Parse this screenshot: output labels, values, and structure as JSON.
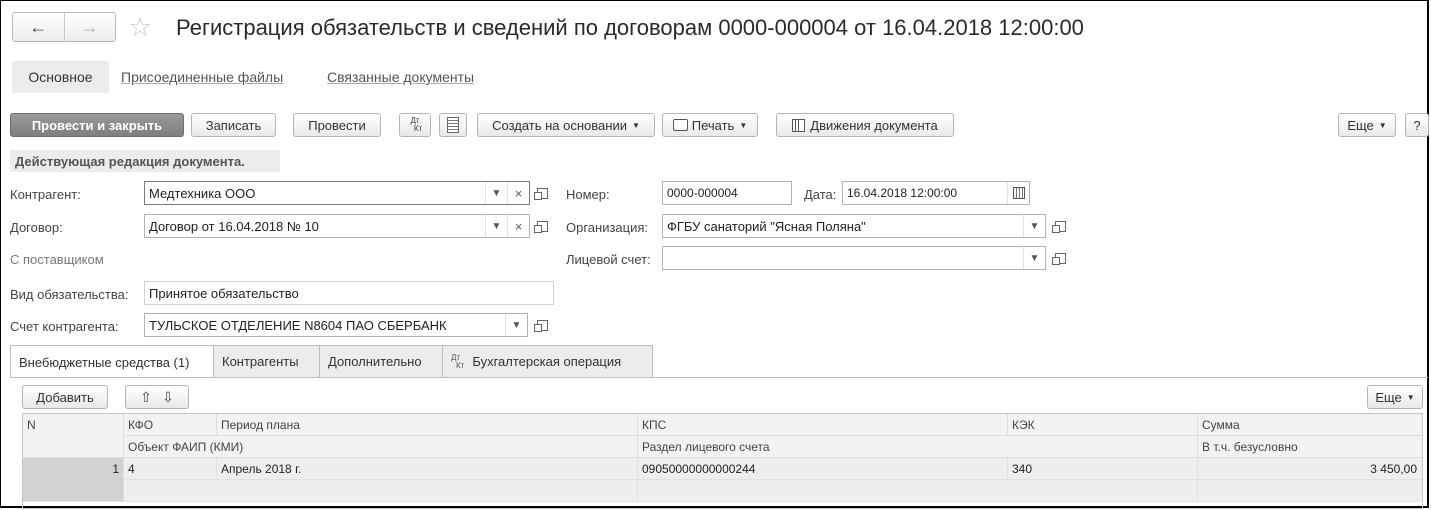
{
  "window": {
    "title": "Регистрация обязательств и сведений по договорам 0000-000004 от 16.04.2018 12:00:00",
    "back_glyph": "←",
    "forward_glyph": "→",
    "star_glyph": "☆"
  },
  "section_tabs": {
    "main": "Основное",
    "files": "Присоединенные файлы",
    "related": "Связанные документы"
  },
  "toolbar": {
    "post_close": "Провести и закрыть",
    "save": "Записать",
    "post": "Провести",
    "dt_kt_top": "Дт",
    "dt_kt_bottom": "Кт",
    "create_based": "Создать на основании",
    "print": "Печать",
    "movements": "Движения документа",
    "more": "Еще",
    "help": "?"
  },
  "status_strip": "Действующая редакция документа.",
  "form": {
    "counterparty_label": "Контрагент:",
    "counterparty_value": "Медтехника ООО",
    "contract_label": "Договор:",
    "contract_value": "Договор от 16.04.2018 № 10",
    "with_supplier": "С поставщиком",
    "obligation_type_label": "Вид обязательства:",
    "obligation_type_value": "Принятое обязательство",
    "counterparty_account_label": "Счет контрагента:",
    "counterparty_account_value": "ТУЛЬСКОЕ ОТДЕЛЕНИЕ N8604 ПАО СБЕРБАНК",
    "number_label": "Номер:",
    "number_value": "0000-000004",
    "date_label": "Дата:",
    "date_value": "16.04.2018 12:00:00",
    "organization_label": "Организация:",
    "organization_value": "ФГБУ санаторий \"Ясная Поляна\"",
    "personal_account_label": "Лицевой счет:",
    "personal_account_value": ""
  },
  "tabs": {
    "extrabudget": "Внебюджетные средства (1)",
    "counterparties": "Контрагенты",
    "additional": "Дополнительно",
    "accounting": "Бухгалтерская операция"
  },
  "table_toolbar": {
    "add": "Добавить",
    "up_glyph": "⇧",
    "down_glyph": "⇩",
    "more": "Еще"
  },
  "table": {
    "header1": [
      "N",
      "КФО",
      "Период плана",
      "КПС",
      "КЭК",
      "Сумма"
    ],
    "header2": [
      "Объект ФАИП (КМИ)",
      "Раздел лицевого счета",
      "В т.ч. безусловно"
    ],
    "rows": [
      {
        "n": "1",
        "kfo": "4",
        "period": "Апрель 2018 г.",
        "kps": "09050000000000244",
        "kek": "340",
        "sum": "3 450,00"
      }
    ]
  }
}
